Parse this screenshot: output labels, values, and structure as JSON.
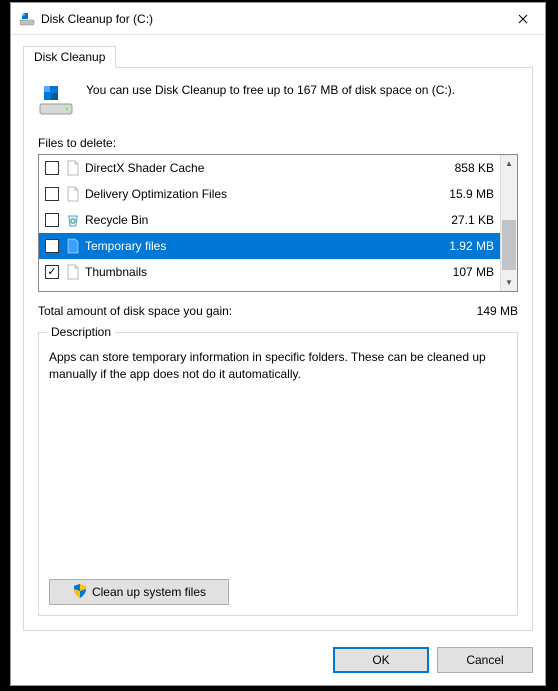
{
  "window": {
    "title": "Disk Cleanup for  (C:)"
  },
  "tab": {
    "label": "Disk Cleanup"
  },
  "intro": {
    "text": "You can use Disk Cleanup to free up to 167 MB of disk space on  (C:)."
  },
  "files_label": "Files to delete:",
  "files": [
    {
      "name": "DirectX Shader Cache",
      "size": "858 KB",
      "checked": false,
      "selected": false,
      "icon": "file"
    },
    {
      "name": "Delivery Optimization Files",
      "size": "15.9 MB",
      "checked": false,
      "selected": false,
      "icon": "file"
    },
    {
      "name": "Recycle Bin",
      "size": "27.1 KB",
      "checked": false,
      "selected": false,
      "icon": "recycle"
    },
    {
      "name": "Temporary files",
      "size": "1.92 MB",
      "checked": false,
      "selected": true,
      "icon": "file-sel"
    },
    {
      "name": "Thumbnails",
      "size": "107 MB",
      "checked": true,
      "selected": false,
      "icon": "file"
    }
  ],
  "total": {
    "label": "Total amount of disk space you gain:",
    "value": "149 MB"
  },
  "description": {
    "title": "Description",
    "text": "Apps can store temporary information in specific folders. These can be cleaned up manually if the app does not do it automatically."
  },
  "buttons": {
    "system_files": "Clean up system files",
    "ok": "OK",
    "cancel": "Cancel"
  }
}
